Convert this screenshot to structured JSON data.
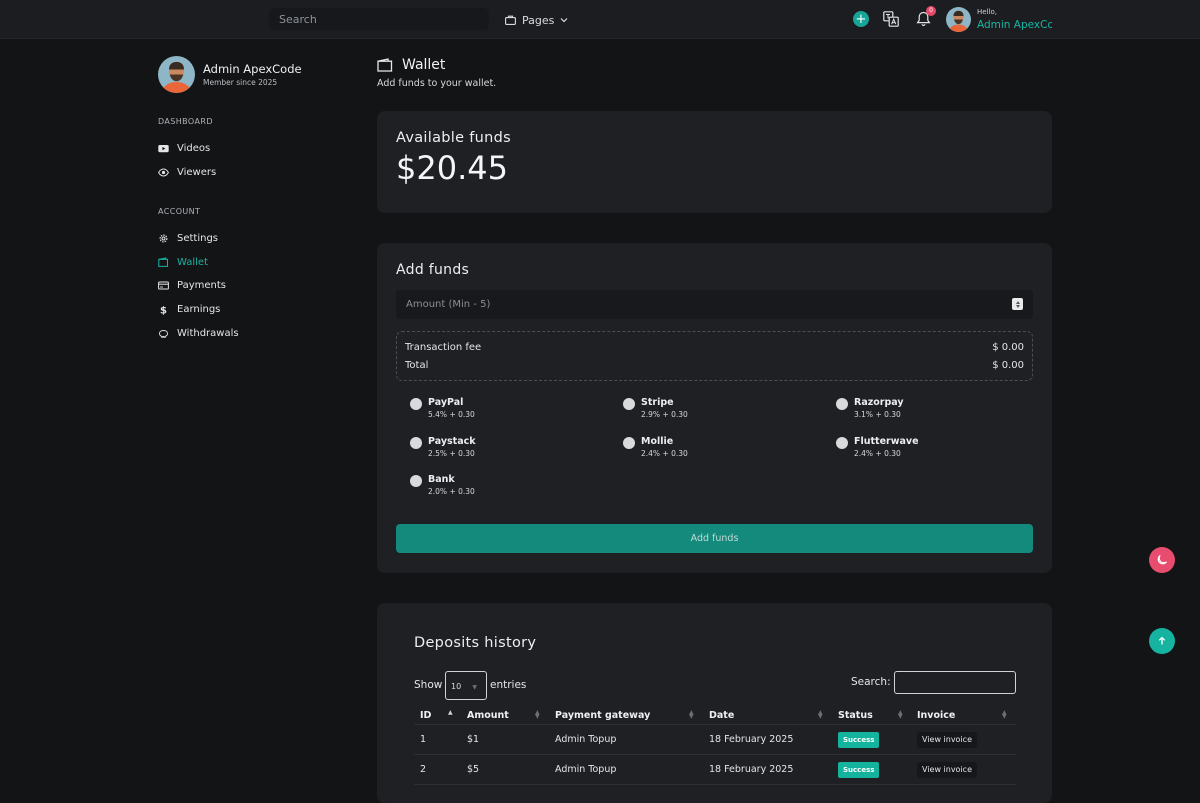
{
  "topbar": {
    "search_placeholder": "Search",
    "pages_label": "Pages",
    "notification_count": "0",
    "hello": "Hello,",
    "user_name": "Admin ApexCode"
  },
  "sidebar": {
    "profile_name": "Admin ApexCode",
    "member_since": "Member since 2025",
    "sections": [
      {
        "title": "DASHBOARD",
        "items": [
          {
            "label": "Videos",
            "icon": "youtube-icon"
          },
          {
            "label": "Viewers",
            "icon": "eye-icon"
          }
        ]
      },
      {
        "title": "ACCOUNT",
        "items": [
          {
            "label": "Settings",
            "icon": "gear-icon"
          },
          {
            "label": "Wallet",
            "icon": "wallet-icon",
            "active": true
          },
          {
            "label": "Payments",
            "icon": "card-icon"
          },
          {
            "label": "Earnings",
            "icon": "dollar-icon"
          },
          {
            "label": "Withdrawals",
            "icon": "piggy-bank-icon"
          }
        ]
      }
    ]
  },
  "page": {
    "title": "Wallet",
    "subtitle": "Add funds to your wallet."
  },
  "funds": {
    "label": "Available funds",
    "value": "$20.45"
  },
  "add_funds": {
    "title": "Add funds",
    "amount_placeholder": "Amount (Min - 5)",
    "fee_label": "Transaction fee",
    "fee_value": "$ 0.00",
    "total_label": "Total",
    "total_value": "$ 0.00",
    "gateways": [
      {
        "name": "PayPal",
        "fee": "5.4% + 0.30"
      },
      {
        "name": "Stripe",
        "fee": "2.9% + 0.30"
      },
      {
        "name": "Razorpay",
        "fee": "3.1% + 0.30"
      },
      {
        "name": "Paystack",
        "fee": "2.5% + 0.30"
      },
      {
        "name": "Mollie",
        "fee": "2.4% + 0.30"
      },
      {
        "name": "Flutterwave",
        "fee": "2.4% + 0.30"
      },
      {
        "name": "Bank",
        "fee": "2.0% + 0.30"
      }
    ],
    "button_label": "Add funds"
  },
  "history": {
    "title": "Deposits history",
    "show_label": "Show",
    "entries_value": "10",
    "entries_label": "entries",
    "search_label": "Search:",
    "columns": [
      "ID",
      "Amount",
      "Payment gateway",
      "Date",
      "Status",
      "Invoice"
    ],
    "rows": [
      {
        "id": "1",
        "amount": "$1",
        "gateway": "Admin Topup",
        "date": "18 February 2025",
        "status": "Success",
        "invoice": "View invoice"
      },
      {
        "id": "2",
        "amount": "$5",
        "gateway": "Admin Topup",
        "date": "18 February 2025",
        "status": "Success",
        "invoice": "View invoice"
      }
    ]
  },
  "colors": {
    "accent": "#16a596",
    "background": "#131416",
    "card": "#1e2024",
    "danger": "#e84d6f"
  }
}
